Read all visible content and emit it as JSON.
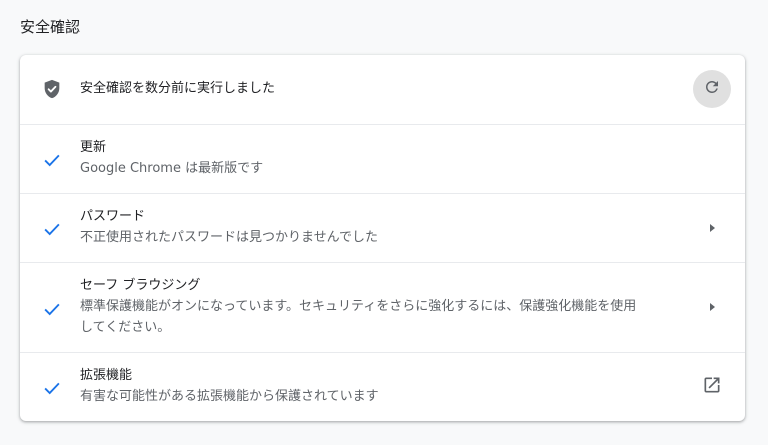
{
  "section_title": "安全確認",
  "colors": {
    "accent": "#1a73e8",
    "shield": "#5f6368",
    "refresh_bg": "#e0e0e0"
  },
  "status": {
    "icon": "shield-icon",
    "text": "安全確認を数分前に実行しました",
    "action_icon": "refresh-icon"
  },
  "items": [
    {
      "icon": "check-icon",
      "title": "更新",
      "detail": "Google Chrome は最新版です",
      "action_icon": ""
    },
    {
      "icon": "check-icon",
      "title": "パスワード",
      "detail": "不正使用されたパスワードは見つかりませんでした",
      "action_icon": "arrow-right-icon"
    },
    {
      "icon": "check-icon",
      "title": "セーフ ブラウジング",
      "detail_line1": "標準保護機能がオンになっています。セキュリティをさらに強化するには、保護強化機能を使用",
      "detail_line2": "してください。",
      "action_icon": "arrow-right-icon"
    },
    {
      "icon": "check-icon",
      "title": "拡張機能",
      "detail": "有害な可能性がある拡張機能から保護されています",
      "action_icon": "external-link-icon"
    }
  ]
}
